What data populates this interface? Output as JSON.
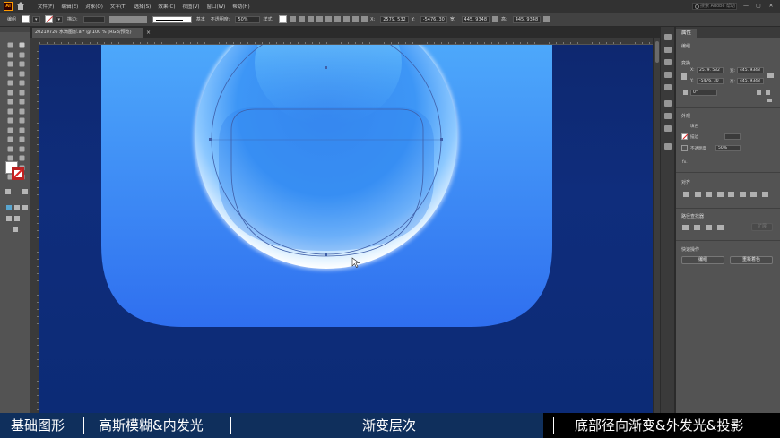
{
  "app": {
    "logo": "Ai",
    "menu": [
      "文件(F)",
      "编辑(E)",
      "对象(O)",
      "文字(T)",
      "选择(S)",
      "效果(C)",
      "视图(V)",
      "窗口(W)",
      "帮助(H)"
    ],
    "search_placeholder": "搜索 Adobe 帮助",
    "window_buttons": [
      "—",
      "▢",
      "✕"
    ]
  },
  "control_bar": {
    "selection_label": "编组",
    "stroke_label": "描边:",
    "stroke_style": "基本",
    "opacity_label": "不透明度:",
    "opacity_value": "50%",
    "style_label": "样式:",
    "x_label": "X:",
    "x_value": "2579. 532",
    "y_label": "Y:",
    "y_value": "-5476. 30",
    "w_label": "宽:",
    "w_value": "445. 9348",
    "h_label": "高:",
    "h_value": "445. 9348"
  },
  "document_tab": {
    "title": "20210726 水滴图形.ai* @ 100 % (RGB/预览)",
    "close": "×"
  },
  "properties_panel": {
    "tab_title": "属性",
    "object_type": "编组",
    "transform_title": "变换",
    "x_label": "X:",
    "x_value": "2579. 532",
    "y_label": "Y:",
    "y_value": "-5476. 30",
    "w_label": "宽:",
    "w_value": "445. 9348",
    "h_label": "高:",
    "h_value": "445. 9348",
    "angle_value": "0°",
    "appearance_title": "外观",
    "fill_label": "填色",
    "stroke_label": "描边",
    "opacity_label": "不透明度",
    "opacity_value": "50%",
    "fx_label": "fx.",
    "align_title": "对齐",
    "pathfinder_title": "路径查找器",
    "expand_label": "扩展",
    "quick_actions_title": "快速操作",
    "ungroup_button": "编组",
    "recolor_button": "重新着色"
  },
  "captions": {
    "item1": "基础图形",
    "item2": "高斯模糊&内发光",
    "item3": "渐变层次",
    "item4": "底部径向渐变&外发光&投影",
    "separator": "|"
  },
  "colors": {
    "canvas_bg": "#0e2870",
    "card_gradient_top": "#4da8fb",
    "card_gradient_bottom": "#2f6fef",
    "drop_highlight": "#ffffff",
    "caption_bar": "#0f2f5c",
    "selection_outline": "#3f5fa8"
  }
}
